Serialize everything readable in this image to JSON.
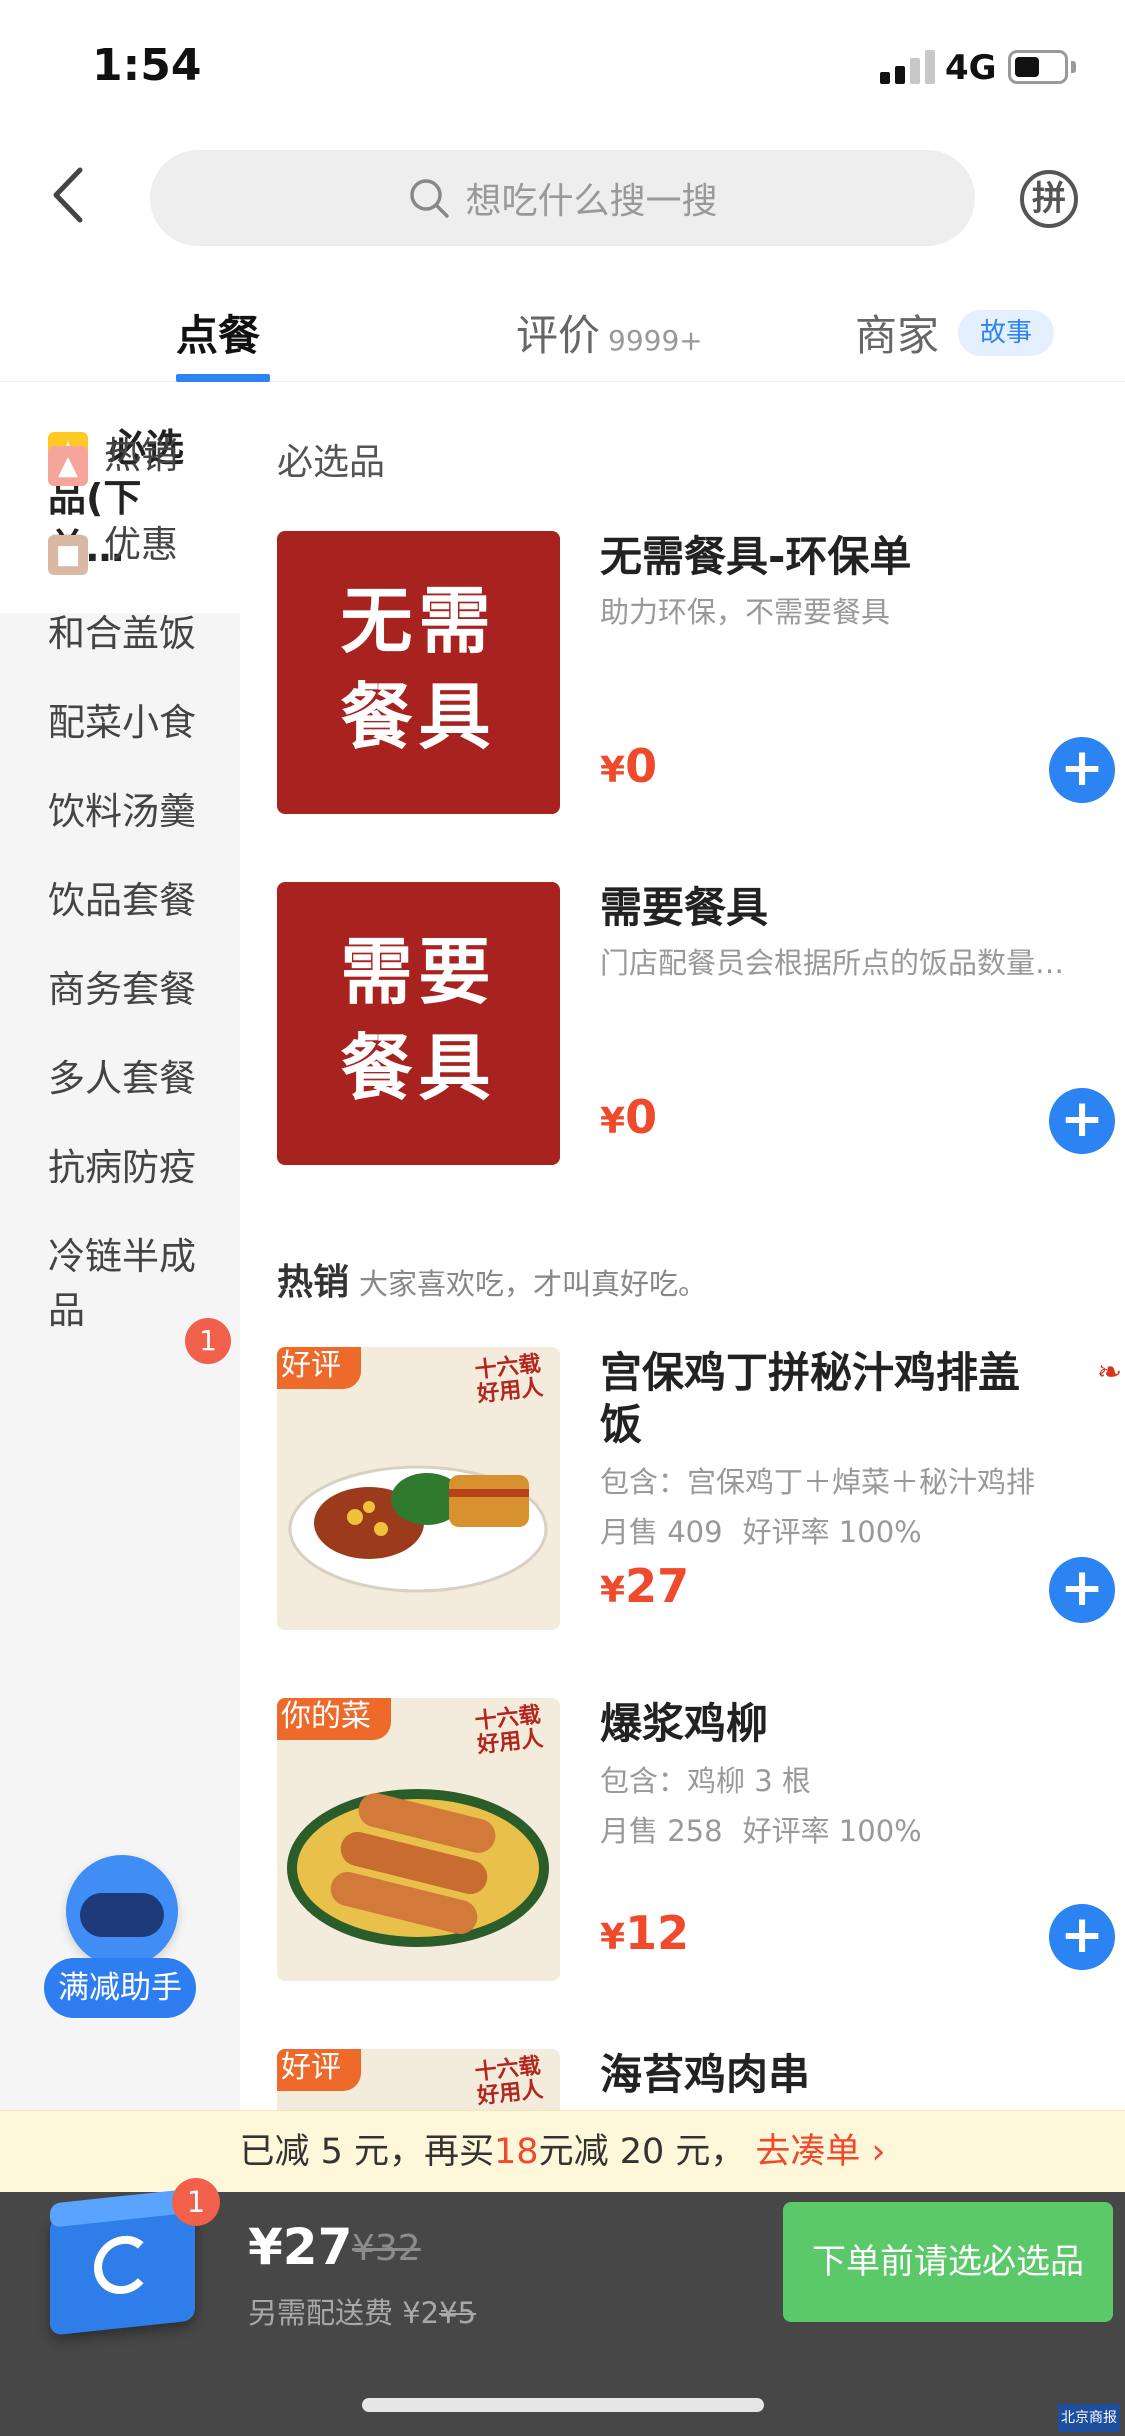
{
  "status": {
    "time": "1:54",
    "network": "4G"
  },
  "search": {
    "placeholder": "想吃什么搜一搜"
  },
  "header": {
    "pin_label": "拼"
  },
  "tabs": [
    {
      "label": "点餐",
      "count": ""
    },
    {
      "label": "评价",
      "count": "9999+"
    },
    {
      "label": "商家",
      "pill": "故事"
    }
  ],
  "sidebar": {
    "active": "必选品(下单…",
    "items": [
      {
        "label": "热销",
        "icon": "flame-icon"
      },
      {
        "label": "优惠",
        "icon": "discount-tag-icon"
      },
      {
        "label": "和合盖饭"
      },
      {
        "label": "配菜小食"
      },
      {
        "label": "饮料汤羹"
      },
      {
        "label": "饮品套餐",
        "badge": "1"
      },
      {
        "label": "商务套餐"
      },
      {
        "label": "多人套餐"
      },
      {
        "label": "抗病防疫"
      },
      {
        "label": "冷链半成品"
      }
    ]
  },
  "helper": {
    "label": "满减助手"
  },
  "sections": [
    {
      "title": "必选品",
      "subtitle": ""
    },
    {
      "title": "热销",
      "subtitle": "大家喜欢吃，才叫真好吃。"
    }
  ],
  "items": [
    {
      "name": "无需餐具-环保单",
      "desc": "助力环保，不需要餐具",
      "price": "0",
      "thumb": "无需\n餐具"
    },
    {
      "name": "需要餐具",
      "desc": "门店配餐员会根据所点的饭品数量…",
      "price": "0",
      "thumb": "需要\n餐具"
    },
    {
      "name": "宫保鸡丁拼秘汁鸡排盖饭",
      "desc": "包含：宫保鸡丁＋焯菜＋秘汁鸡排",
      "monthly": "月售 409",
      "rating": "好评率 100%",
      "price": "27",
      "tag": "好评"
    },
    {
      "name": "爆浆鸡柳",
      "desc": "包含：鸡柳 3 根",
      "monthly": "月售 258",
      "rating": "好评率 100%",
      "price": "12",
      "tag": "你的菜"
    },
    {
      "name": "海苔鸡肉串",
      "tag": "好评"
    }
  ],
  "brand_mark": "十六载\n好用人",
  "currency": "¥",
  "promo": {
    "pre": "已减 5 元，再买",
    "amount": "18",
    "post": "元减 20 元，",
    "link": "去凑单 ›"
  },
  "cart": {
    "badge": "1",
    "total": "¥27",
    "original": "¥32",
    "delivery_pre": "另需配送费 ¥2",
    "delivery_strike": "¥5",
    "checkout": "下单前请选必选品"
  },
  "watermark": "北京商报",
  "colors": {
    "accent": "#2b84f1",
    "price": "#f04a2c",
    "checkout": "#5bc96a",
    "cartbar": "#474747",
    "promo_bg": "#fff7d9"
  }
}
